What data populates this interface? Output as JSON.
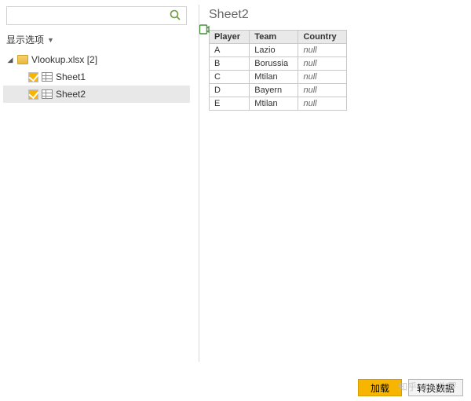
{
  "search": {
    "placeholder": ""
  },
  "options_label": "显示选项",
  "tree": {
    "file_label": "Vlookup.xlsx [2]",
    "sheets": [
      "Sheet1",
      "Sheet2"
    ],
    "selected_index": 1
  },
  "preview": {
    "title": "Sheet2",
    "columns": [
      "Player",
      "Team",
      "Country"
    ],
    "rows": [
      {
        "player": "A",
        "team": "Lazio",
        "country": null
      },
      {
        "player": "B",
        "team": "Borussia",
        "country": null
      },
      {
        "player": "C",
        "team": "Mtilan",
        "country": null
      },
      {
        "player": "D",
        "team": "Bayern",
        "country": null
      },
      {
        "player": "E",
        "team": "Mtilan",
        "country": null
      }
    ],
    "null_text": "null"
  },
  "footer": {
    "load": "加载",
    "transform": "转换数据"
  },
  "watermark": "知乎 @BI佐罗"
}
